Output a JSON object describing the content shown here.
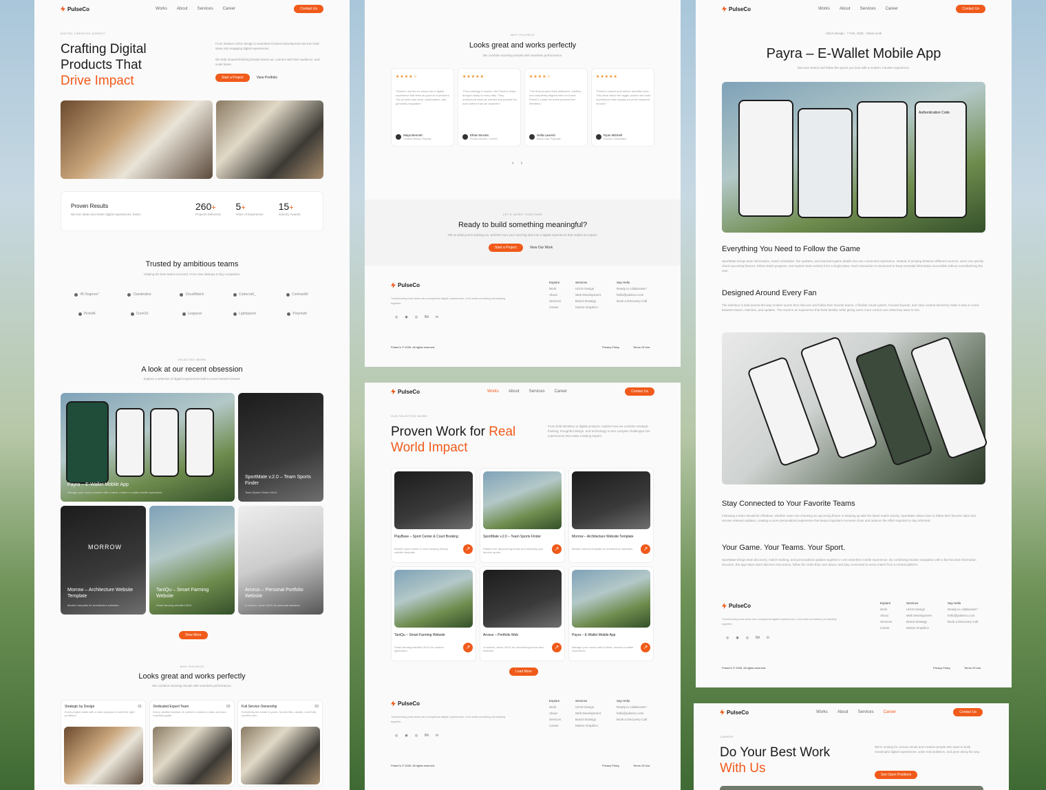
{
  "brand": "PulseCo",
  "nav": {
    "works": "Works",
    "about": "About",
    "services": "Services",
    "career": "Career",
    "contact": "Contact Us"
  },
  "p1": {
    "eyebrow": "DIGITAL CREATIVE AGENCY",
    "h1a": "Crafting Digital",
    "h1b": "Products That",
    "h1c": "Drive Impact",
    "intro1": "From intuitive UI/UX design to seamless frontend development we turn bold ideas into engaging digital experiences.",
    "intro2": "We help forward-thinking brands stand out, connect with their audience, and scale faster.",
    "start": "Start a Project",
    "portfolio": "View Portfolio",
    "proven": "Proven Results",
    "proven_sub": "We turn ideas into better digital experiences, faster.",
    "stats": [
      {
        "n": "260",
        "l": "Projects Delivered"
      },
      {
        "n": "5",
        "l": "Years of Experience"
      },
      {
        "n": "15",
        "l": "Industry Awards"
      }
    ],
    "plus": "+",
    "trusted": "Trusted by ambitious teams",
    "trusted_sub": "Helping the best teams succeed. From new startups to big companies.",
    "logos": [
      "45 Degrees°",
      "Clandestine",
      "CloudWatch",
      "Codecraft_",
      "ContrastAI",
      "PictelAI",
      "CoreOS",
      "Leapyear",
      "Lightspeed",
      "Polymath"
    ],
    "sel_eyebrow": "SELECTED WORK",
    "sel_title": "A look at our recent obsession",
    "sel_sub": "Explore a selection of digital experiences built to move brands forward.",
    "works": [
      {
        "t": "Payra – E-Wallet Mobile App",
        "d": "Manage your money smarter with a sleek, modern e-wallet mobile experience."
      },
      {
        "t": "SportMate v.2.0 – Team Sports Finder",
        "d": "Team Sports Finder UI/UX"
      },
      {
        "t": "Morrow – Architecture Website Template",
        "d": "Modern template for architecture websites."
      },
      {
        "t": "TaniQu – Smart Farming Website",
        "d": "Smart farming website UI/UX"
      },
      {
        "t": "Arceus – Personal Portfolio Website",
        "d": "A modern, clean UI/UX for personal websites."
      }
    ],
    "morrow": "MORROW",
    "view_more": "View More",
    "why_eyebrow": "WHY PULSECO",
    "why_title": "Looks great and works perfectly",
    "why_sub": "We combine stunning visuals with seamless performance.",
    "feats": [
      {
        "t": "Strategic by Design",
        "n": "01",
        "d": "Every project starts with a clear purpose to solve the right problems."
      },
      {
        "t": "Dedicated Expert Team",
        "n": "02",
        "d": "Every creative decision is rooted in research, data, and your business goals."
      },
      {
        "t": "Full Service Ownership",
        "n": "03",
        "d": "Everything we create is yours. Source files, assets, code fully handed over."
      }
    ]
  },
  "p2": {
    "eyebrow": "WHY PULSECO",
    "title": "Looks great and works perfectly",
    "sub": "We combine stunning visuals with seamless performance.",
    "reviews": [
      {
        "q": "\"PulseCo turned our vision into a digital experience that feels as good as it performs. The process was clear, collaborative, and genuinely enjoyable.\"",
        "n": "Maya Bennett",
        "r": "Creative Director, Prismify"
      },
      {
        "q": "\"From strategy to launch, the PulseCo team brought clarity to every step. They understood what we needed and pushed the work further than we expected.\"",
        "n": "Ethan Brooks",
        "r": "Product Director, CoreOS"
      },
      {
        "q": "\"The final product feels distinctive, intuitive, and completely aligned with our brand. PulseCo made the entire process feel effortless.\"",
        "n": "Sofia Laurent",
        "r": "Brand Lead, Polymath"
      },
      {
        "q": "\"PulseCo doesn't just deliver beautiful work. They think about the bigger picture and build experiences that actually move the business forward.\"",
        "n": "Ryan Mitchell",
        "r": "Founder, Clandestine"
      }
    ],
    "stars": "★★★★★",
    "stars4": "★★★★☆",
    "prev": "‹",
    "next": "›",
    "cta_eyebrow": "LET'S WORK TOGETHER",
    "cta_title": "Ready to build something meaningful?",
    "cta_sub": "Tell us what you're working on, and let's turn your next big idea into a digital experience that makes an impact.",
    "cta_start": "Start a Project",
    "cta_view": "View Our Work"
  },
  "footer": {
    "desc": "Transforming bold ideas into exceptional digital experiences. Let's build something remarkably together.",
    "explore": "Explore",
    "explore_items": [
      "Work",
      "About",
      "Services",
      "Career"
    ],
    "services": "Services",
    "services_items": [
      "UI/UX Design",
      "Web Development",
      "Brand Strategy",
      "Motion Graphics"
    ],
    "hello": "Say Hello",
    "hello_items": [
      "Ready to collaborate?",
      "hello@pulseco.com",
      "Book a Discovery Call"
    ],
    "copy": "PulseCo © 2026. All rights reserved.",
    "privacy": "Privacy Policy",
    "terms": "Terms Of Use",
    "social": [
      "◎",
      "◉",
      "◎",
      "Bē",
      "in"
    ]
  },
  "p3": {
    "eyebrow": "OUR SELECTED WORK",
    "h1a": "Proven Work for ",
    "h1b": "Real",
    "h1c": "World Impact",
    "intro": "From bold identities to digital products, explore how we combine strategic thinking, thoughtful design, and technology to turn complex challenges into experiences that make a lasting impact.",
    "items": [
      {
        "t": "PlayBase – Sport Center & Court Booking",
        "d": "Modern sport center & court booking Next.js website template."
      },
      {
        "t": "SportMate v.2.0 – Team Sports Finder",
        "d": "Platform for discovering teams and following your favorite sports."
      },
      {
        "t": "Morrow – Architecture Website Template",
        "d": "Modern Next.js template for architecture websites."
      },
      {
        "t": "TaniQu – Smart Farming Website",
        "d": "Smart farming website UI/UX for modern agriculture."
      },
      {
        "t": "Arceus – Portfolio Web",
        "d": "A modern, clean UI/UX for discovering teams and matches."
      },
      {
        "t": "Payra – E-Wallet Mobile App",
        "d": "Manage your money with a sleek, modern e-wallet experience."
      }
    ],
    "load": "Load More",
    "arrow": "↗"
  },
  "p4": {
    "meta": "UI/UX Design  ·  7 Feb, 2026  ·  Share work",
    "title": "Payra – E-Wallet Mobile App",
    "sub": "Discover teams and follow the sports you love with a modern, intuitive experience.",
    "s1": "Everything You Need to Follow the Game",
    "s1d": "SportMate brings team information, match schedules, live updates, and important game details into one connected experience. Instead of jumping between different sources, users can quickly check upcoming fixtures, follow match progress, and explore team activity from a single place. Each interaction is structured to keep essential information accessible without overwhelming the user.",
    "s2": "Designed Around Every Fan",
    "s2d": "The interface is built around the way modern sports fans discover and follow their favorite teams. A flexible visual system, focused layouts, and clear content hierarchy make it easy to move between teams, matches, and updates. The result is an experience that feels familiar while giving users more control over what they want to see.",
    "s3": "Stay Connected to Your Favorite Teams",
    "s3d": "Following a team should be effortless, whether users are checking an upcoming fixture or keeping up with the latest match activity. SportMate allows fans to follow their favorite clubs and receive relevant updates, creating a more personalized experience that keeps important moments close and reduces the effort required to stay informed.",
    "s4": "Your Game. Your Teams. Your Sport.",
    "s4d": "SportMate brings team discovery, match tracking, and personalized updates together in one seamless mobile experience. By combining intuitive navigation with a fan-focused information structure, the app helps users discover new teams, follow the clubs they care about, and stay connected to every match from a central platform.",
    "auth": "Authentication Code"
  },
  "p5": {
    "eyebrow": "CAREER",
    "h1a": "Do Your Best Work",
    "h1b": "With Us",
    "intro": "We're looking for curious minds and creative people who want to build meaningful digital experiences, solve real problems, and grow along the way.",
    "btn": "See Open Positions"
  }
}
